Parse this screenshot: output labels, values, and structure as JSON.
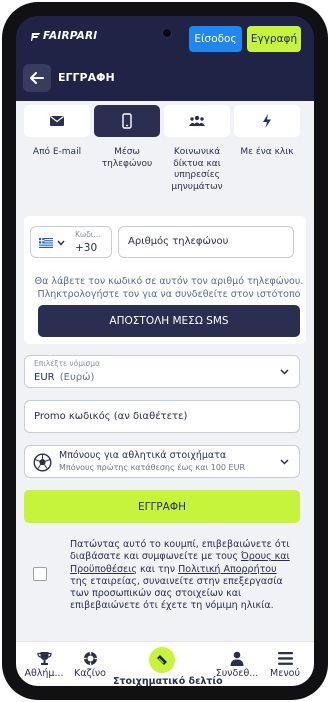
{
  "header": {
    "logo_text": "FAIRPARI",
    "login_label": "Είσοδος",
    "register_label": "Εγγραφή"
  },
  "titlebar": {
    "title": "ΕΓΓΡΑΦΗ"
  },
  "tabs": [
    {
      "label": "Από E-mail",
      "icon": "mail-icon"
    },
    {
      "label": "Μέσω τηλεφώνου",
      "icon": "phone-icon",
      "active": true
    },
    {
      "label": "Κοινωνικά δίκτυα και υπηρεσίες μηνυμάτων",
      "icon": "users-icon"
    },
    {
      "label": "Με ένα κλικ",
      "icon": "lightning-icon"
    }
  ],
  "phone_form": {
    "country_code_label": "Κωδι...",
    "country_code_value": "+30",
    "phone_placeholder": "Αριθμός τηλεφώνου",
    "hint": "Θα λάβετε τον κωδικό σε αυτόν τον αριθμό τηλεφώνου. Πληκτρολογήστε τον για να συνδεθείτε στον ιστότοπο",
    "sms_button": "ΑΠΟΣΤΟΛΗ ΜΕΣΩ SMS"
  },
  "currency": {
    "label": "Επιλέξτε νόμισμα",
    "code": "EUR",
    "name": "(Ευρώ)"
  },
  "promo": {
    "placeholder": "Promo κωδικός (αν διαθέτετε)"
  },
  "bonus": {
    "title": "Μπόνους για αθλητικά στοιχήματα",
    "subtitle": "Μπόνους πρώτης κατάθεσης έως και 100 EUR"
  },
  "submit_label": "ΕΓΓΡΑΦΗ",
  "terms": {
    "part1": "Πατώντας αυτό το κουμπί, επιβεβαιώνετε ότι διαβάσατε και συμφωνείτε με τους ",
    "link1": "Όρους και Προϋποθέσεις",
    "part2": " και την ",
    "link2": "Πολιτική Απορρήτου",
    "part3": " της εταιρείας, συναινείτε στην επεξεργασία των προσωπικών σας στοιχείων και επιβεβαιώνετε ότι έχετε τη νόμιμη ηλικία."
  },
  "bottom_nav": {
    "sports": "Αθλήμ...",
    "casino": "Καζίνο",
    "betslip": "Στοιχηματικό δελτίο",
    "login": "Συνδεθ...",
    "menu": "Μενού"
  },
  "colors": {
    "navy": "#1f2447",
    "dark": "#2a2f52",
    "lime": "#c5f43a",
    "blue": "#1f86f2",
    "hint": "#5b6a95"
  }
}
